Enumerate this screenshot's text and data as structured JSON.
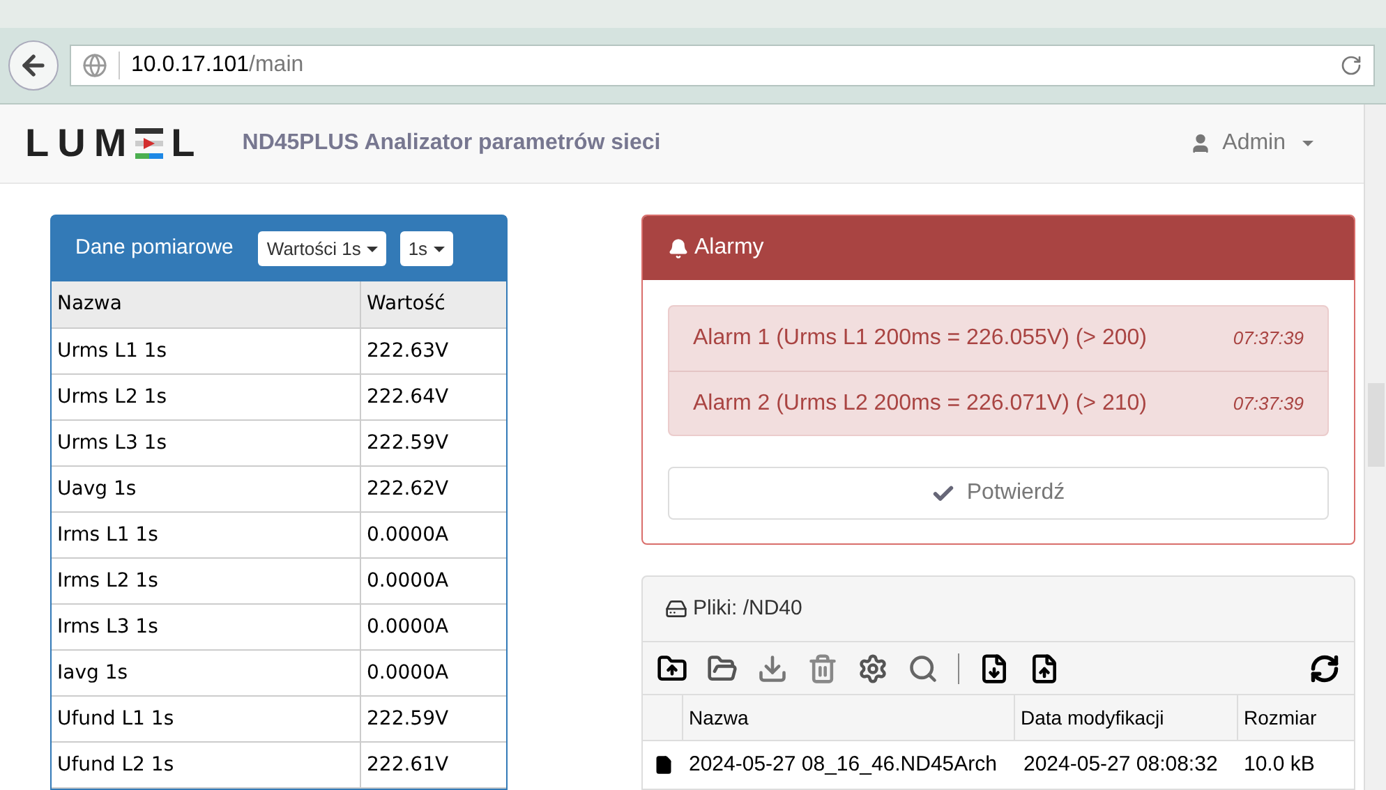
{
  "browser": {
    "url_host": "10.0.17.101",
    "url_path": "/main"
  },
  "navbar": {
    "logo_start": "LUM",
    "logo_end": "L",
    "title": "ND45PLUS Analizator parametrów sieci",
    "user": "Admin"
  },
  "measurements": {
    "title": "Dane pomiarowe",
    "dropdowns": [
      "Wartości 1s",
      "1s"
    ],
    "columns": [
      "Nazwa",
      "Wartość"
    ],
    "rows": [
      {
        "name": "Urms L1 1s",
        "value": "222.63V"
      },
      {
        "name": "Urms L2 1s",
        "value": "222.64V"
      },
      {
        "name": "Urms L3 1s",
        "value": "222.59V"
      },
      {
        "name": "Uavg 1s",
        "value": "222.62V"
      },
      {
        "name": "Irms L1 1s",
        "value": "0.0000A"
      },
      {
        "name": "Irms L2 1s",
        "value": "0.0000A"
      },
      {
        "name": "Irms L3 1s",
        "value": "0.0000A"
      },
      {
        "name": "Iavg 1s",
        "value": "0.0000A"
      },
      {
        "name": "Ufund L1 1s",
        "value": "222.59V"
      },
      {
        "name": "Ufund L2 1s",
        "value": "222.61V"
      }
    ]
  },
  "alarms": {
    "title": "Alarmy",
    "items": [
      {
        "text": "Alarm 1 (Urms L1 200ms = 226.055V) (> 200)",
        "time": "07:37:39"
      },
      {
        "text": "Alarm 2 (Urms L2 200ms = 226.071V) (> 210)",
        "time": "07:37:39"
      }
    ],
    "confirm_button": "Potwierdź"
  },
  "files": {
    "title": "Pliki: /ND40",
    "columns": [
      "Nazwa",
      "Data modyfikacji",
      "Rozmiar"
    ],
    "rows": [
      {
        "name": "2024-05-27 08_16_46.ND45Arch",
        "modified": "2024-05-27 08:08:32",
        "size": "10.0 kB"
      }
    ]
  }
}
